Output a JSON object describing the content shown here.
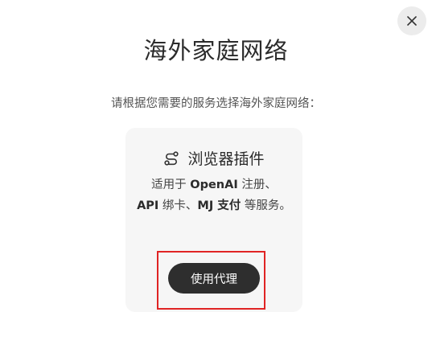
{
  "dialog": {
    "title": "海外家庭网络",
    "subtitle": "请根据您需要的服务选择海外家庭网络："
  },
  "card": {
    "icon": "route-icon",
    "title": "浏览器插件",
    "desc": {
      "p1": "适用于 ",
      "b1": "OpenAI",
      "p2": " 注册、",
      "b2": "API",
      "p3": " 绑卡、",
      "b3": "MJ",
      "p4": " 支付",
      "p5": " 等服务。"
    },
    "button_label": "使用代理"
  },
  "close_icon": "close-icon",
  "colors": {
    "button_bg": "#2e2e2e",
    "card_bg": "#f6f6f6",
    "highlight": "#e02424"
  }
}
